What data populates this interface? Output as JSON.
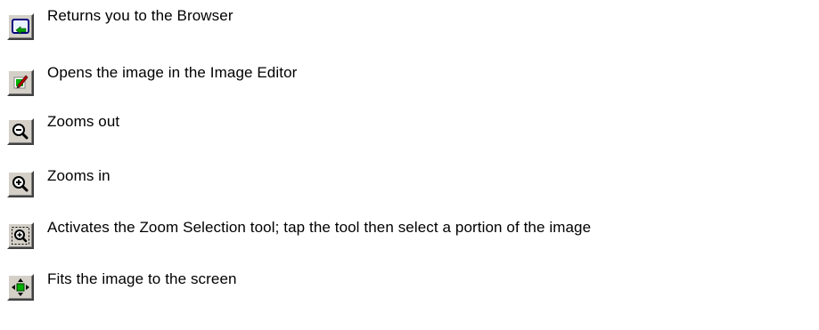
{
  "toolbar_items": [
    {
      "icon": "browser-return-icon",
      "description": "Returns you to the Browser"
    },
    {
      "icon": "image-editor-icon",
      "description": "Opens the image in the Image Editor"
    },
    {
      "icon": "zoom-out-icon",
      "description": "Zooms out"
    },
    {
      "icon": "zoom-in-icon",
      "description": "Zooms in"
    },
    {
      "icon": "zoom-selection-icon",
      "description": "Activates the Zoom Selection tool; tap the tool then select a portion of the image"
    },
    {
      "icon": "fit-to-screen-icon",
      "description": "Fits the image to the screen"
    }
  ],
  "colors": {
    "button_face": "#d4d0c8",
    "accent_green": "#00a000",
    "accent_blue": "#000080"
  }
}
